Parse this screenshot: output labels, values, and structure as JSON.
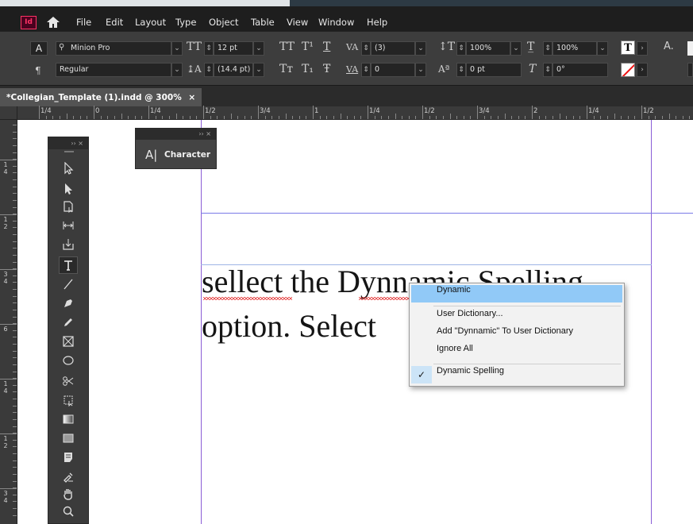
{
  "app": {
    "logo_text": "Id"
  },
  "menu": [
    "File",
    "Edit",
    "Layout",
    "Type",
    "Object",
    "Table",
    "View",
    "Window",
    "Help"
  ],
  "control_panel": {
    "font_family": "Minion Pro",
    "font_style": "Regular",
    "font_size": "12 pt",
    "leading": "(14.4 pt)",
    "kerning": "(3)",
    "tracking": "0",
    "vertical_scale": "100%",
    "horizontal_scale": "100%",
    "baseline_shift": "0 pt",
    "skew": "0°",
    "char_mode_label": "A",
    "para_mode_label": "¶",
    "caps_all": "TT",
    "superscript": "T¹",
    "underline": "T",
    "small_caps": "Tт",
    "subscript": "T₁",
    "strikethrough": "Ŧ",
    "stroke_label": "A."
  },
  "tab": {
    "title": "*Collegian_Template (1).indd @ 300%",
    "close": "×"
  },
  "ruler_top_labels": [
    "1/4",
    "0",
    "1/4",
    "1/2",
    "3/4",
    "1",
    "1/4",
    "1/2",
    "3/4",
    "2",
    "1/4",
    "1/2"
  ],
  "ruler_left_labels": [
    "1\n4",
    "1\n2",
    "3\n4",
    "6",
    "1\n4",
    "1\n2",
    "3\n4"
  ],
  "document": {
    "line1_word1": "sellect",
    "line1_rest": " the Dynnamic Spelling",
    "line2": "option. Select"
  },
  "panels": {
    "character": {
      "label": "Character",
      "icon": "A|",
      "header_controls": "››  ×"
    },
    "tools": {
      "header_controls": "››  ×"
    }
  },
  "context_menu": {
    "suggestion": "Dynamic",
    "user_dictionary": "User Dictionary...",
    "add_to_dictionary": "Add \"Dynnamic\" To User Dictionary",
    "ignore_all": "Ignore All",
    "dynamic_spelling": "Dynamic Spelling",
    "dynamic_spelling_checked": true,
    "check_glyph": "✓"
  },
  "colors": {
    "accent_highlight": "#91c9f7",
    "page_margin": "#8a5dd6",
    "spelling_error": "#e02020",
    "app_brand": "#ff3366"
  }
}
